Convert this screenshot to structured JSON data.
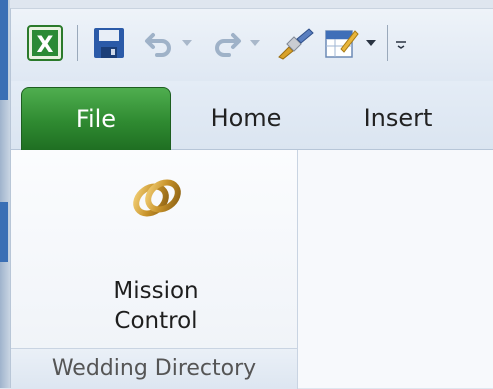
{
  "quick_access": {
    "icons": [
      "excel-icon",
      "save-icon",
      "undo-icon",
      "redo-icon",
      "format-painter-icon",
      "sheet-properties-icon"
    ]
  },
  "tabs": [
    {
      "label": "File",
      "active": true
    },
    {
      "label": "Home",
      "active": false
    },
    {
      "label": "Insert",
      "active": false
    }
  ],
  "ribbon": {
    "group": {
      "label": "Wedding Directory",
      "button": {
        "line1": "Mission",
        "line2": "Control",
        "icon": "wedding-rings-icon"
      }
    }
  },
  "colors": {
    "file_tab": "#2f8a31",
    "excel_green": "#1f7a2a",
    "save_blue": "#2b5aa8"
  }
}
